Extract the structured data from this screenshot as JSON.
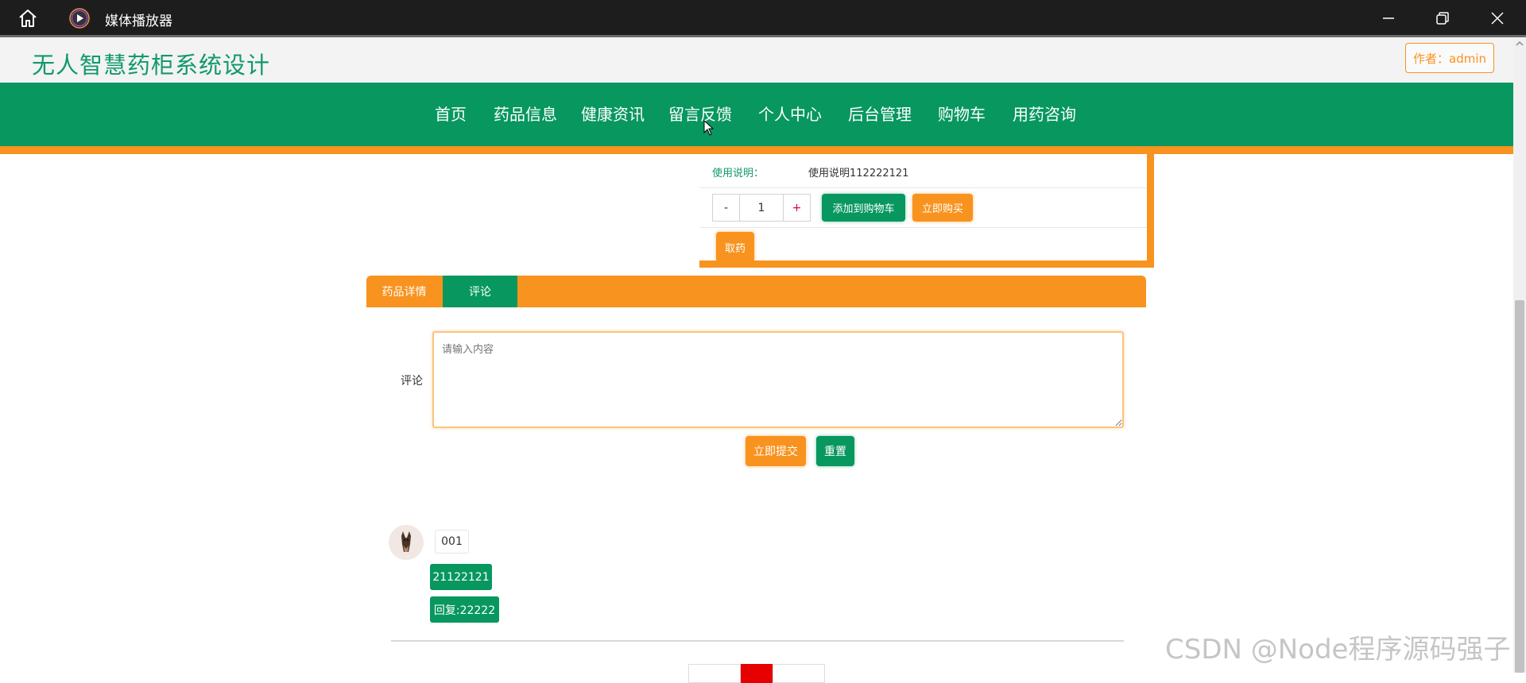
{
  "window": {
    "title": "媒体播放器",
    "icons": [
      "home-icon",
      "media-player-icon",
      "minimize-icon",
      "restore-icon",
      "close-icon"
    ]
  },
  "header": {
    "site_title": "无人智慧药柜系统设计",
    "author_label": "作者：admin"
  },
  "nav": {
    "items": [
      {
        "label": "首页"
      },
      {
        "label": "药品信息"
      },
      {
        "label": "健康资讯"
      },
      {
        "label": "留言反馈"
      },
      {
        "label": "个人中心"
      },
      {
        "label": "后台管理"
      },
      {
        "label": "购物车"
      },
      {
        "label": "用药咨询"
      }
    ]
  },
  "product": {
    "usage_label": "使用说明：",
    "usage_value": "使用说明112222121",
    "quantity": {
      "minus": "-",
      "value": "1",
      "plus": "+"
    },
    "add_to_cart_label": "添加到购物车",
    "buy_now_label": "立即购买",
    "take_medicine_label": "取药"
  },
  "tabs": [
    {
      "label": "药品详情"
    },
    {
      "label": "评论",
      "active": true
    }
  ],
  "comment_form": {
    "label": "评论",
    "placeholder": "请输入内容",
    "submit_label": "立即提交",
    "reset_label": "重置"
  },
  "comments": [
    {
      "username": "001",
      "content": "21122121",
      "reply": "回复:22222"
    }
  ],
  "watermark": "CSDN @Node程序源码强子",
  "colors": {
    "primary_green": "#07975f",
    "accent_orange": "#f7931e",
    "title_green": "#12996a"
  }
}
